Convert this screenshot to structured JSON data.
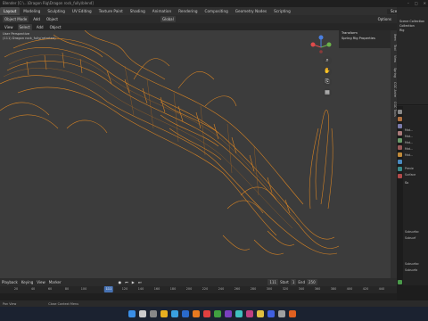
{
  "window": {
    "title": "Blender [C:\\...\\Dragon Rig\\Dragon rock_fully\\blend]"
  },
  "workspaces": [
    "Layout",
    "Modeling",
    "Sculpting",
    "UV Editing",
    "Texture Paint",
    "Shading",
    "Animation",
    "Rendering",
    "Compositing",
    "Geometry Nodes",
    "Scripting"
  ],
  "scene": {
    "name": "Scene"
  },
  "toolbar": {
    "mode": "Object Mode",
    "add": "Add",
    "object": "Object",
    "orientation": "Global",
    "options": "Options"
  },
  "viewport_header": {
    "view": "View",
    "select": "Select",
    "add": "Add",
    "object": "Object"
  },
  "viewport_info": {
    "line1": "User Perspective",
    "line2": "(111) Dragon rock_fully(retarted)"
  },
  "npanel": {
    "transform": "Transform",
    "spring_rig": "Spring Rig Properties"
  },
  "npanel_tabs": [
    "Item",
    "Tool",
    "View",
    "Spring",
    "CGC Anim",
    "CGC Tools"
  ],
  "outliner": [
    "Scene Collection",
    "Collection",
    "Rig"
  ],
  "props": {
    "rows": [
      "Mat...",
      "Mat...",
      "Mat...",
      "Mat...",
      "Mat...",
      "Previe",
      "Surface",
      "Su",
      "Subsurfac",
      "Subsurf",
      "Subsurfac",
      "Subsurfa"
    ]
  },
  "timeline": {
    "playback": "Playback",
    "keying": "Keying",
    "view": "View",
    "marker": "Marker",
    "current_frame": "111",
    "start_label": "Start",
    "start": "1",
    "end_label": "End",
    "end": "250",
    "ticks": [
      "20",
      "40",
      "60",
      "80",
      "100",
      "120",
      "140",
      "160",
      "180",
      "200",
      "220",
      "240",
      "260",
      "280",
      "300",
      "320",
      "340",
      "360",
      "380",
      "400",
      "420",
      "440"
    ]
  },
  "statusbar": {
    "left": "Pan View",
    "right": "Close Context Menu"
  },
  "colors": {
    "wire": "#e58a22",
    "accent": "#4772b3",
    "viewport_bg": "#3c3c3c"
  }
}
